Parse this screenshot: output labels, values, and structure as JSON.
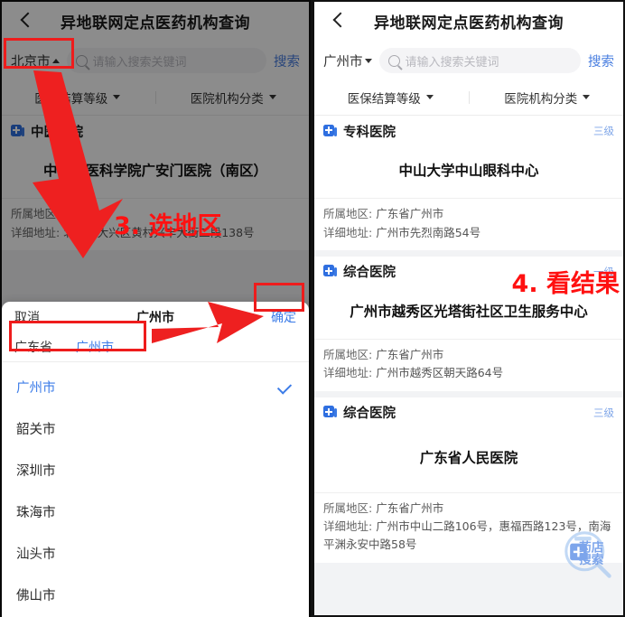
{
  "annotations": {
    "step3": "3. 选地区",
    "step4": "4. 看结果",
    "color": "#ff1111"
  },
  "watermark": {
    "line1": "药店",
    "line2": "搜索"
  },
  "left_panel": {
    "nav": {
      "back_icon": "back-chevron-icon",
      "title": "异地联网定点医药机构查询"
    },
    "search": {
      "city": "北京市",
      "caret": "caret-up-icon",
      "placeholder": "请输入搜索关键词",
      "button": "搜索",
      "icon": "search-icon"
    },
    "filters": [
      {
        "label": "医保结算等级",
        "caret": "caret-down-icon"
      },
      {
        "label": "医院机构分类",
        "caret": "caret-down-icon"
      }
    ],
    "result": {
      "type": "中医医院",
      "name": "中国中医科学院广安门医院（南区）",
      "region_key": "所属地区:",
      "region_value": "北京市",
      "address_key": "详细地址:",
      "address_value": "北京市大兴区黄村兴丰大街二段138号"
    },
    "picker": {
      "cancel": "取消",
      "title": "广州市",
      "confirm": "确定",
      "tabs": [
        {
          "label": "广东省",
          "active": false
        },
        {
          "label": "广州市",
          "active": true
        }
      ],
      "options": [
        {
          "label": "广州市",
          "selected": true
        },
        {
          "label": "韶关市",
          "selected": false
        },
        {
          "label": "深圳市",
          "selected": false
        },
        {
          "label": "珠海市",
          "selected": false
        },
        {
          "label": "汕头市",
          "selected": false
        },
        {
          "label": "佛山市",
          "selected": false
        }
      ]
    }
  },
  "right_panel": {
    "nav": {
      "back_icon": "back-chevron-icon",
      "title": "异地联网定点医药机构查询"
    },
    "search": {
      "city": "广州市",
      "caret": "caret-down-icon",
      "placeholder": "请输入搜索关键词",
      "button": "搜索",
      "icon": "search-icon"
    },
    "filters": [
      {
        "label": "医保结算等级",
        "caret": "caret-down-icon"
      },
      {
        "label": "医院机构分类",
        "caret": "caret-down-icon"
      }
    ],
    "results": [
      {
        "type": "专科医院",
        "grade": "三级",
        "name": "中山大学中山眼科中心",
        "region_key": "所属地区:",
        "region_value": "广东省广州市",
        "address_key": "详细地址:",
        "address_value": "广州市先烈南路54号"
      },
      {
        "type": "综合医院",
        "grade": "一级",
        "name": "广州市越秀区光塔街社区卫生服务中心",
        "region_key": "所属地区:",
        "region_value": "广东省广州市",
        "address_key": "详细地址:",
        "address_value": "广州市越秀区朝天路64号"
      },
      {
        "type": "综合医院",
        "grade": "三级",
        "name": "广东省人民医院",
        "region_key": "所属地区:",
        "region_value": "广东省广州市",
        "address_key": "详细地址:",
        "address_value": "广州市中山二路106号，惠福西路123号，南海平渊永安中路58号"
      }
    ]
  }
}
